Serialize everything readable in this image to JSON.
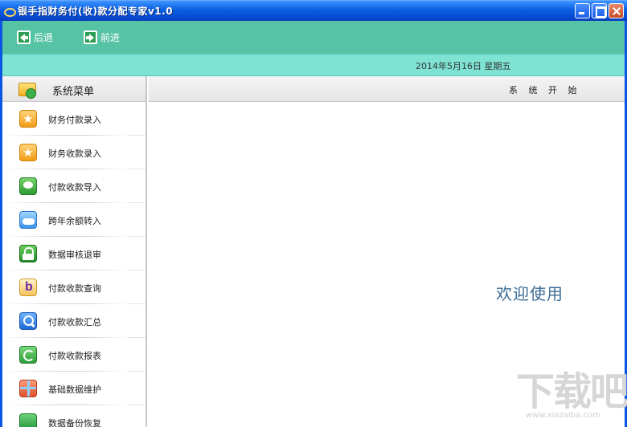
{
  "window": {
    "title": "银手指财务付(收)款分配专家v1.0"
  },
  "toolbar": {
    "back_label": "后退",
    "forward_label": "前进"
  },
  "infobar": {
    "date": "2014年5月16日  星期五"
  },
  "sidebar": {
    "title": "系统菜单",
    "items": [
      {
        "label": "财务付款录入",
        "icon": "star-icon"
      },
      {
        "label": "财务收款录入",
        "icon": "star-icon"
      },
      {
        "label": "付款收款导入",
        "icon": "chat-bubble-icon"
      },
      {
        "label": "跨年余额转入",
        "icon": "cloud-icon"
      },
      {
        "label": "数据审核退审",
        "icon": "lock-icon"
      },
      {
        "label": "付款收款查询",
        "icon": "b-letter-icon"
      },
      {
        "label": "付款收款汇总",
        "icon": "search-icon"
      },
      {
        "label": "付款收款报表",
        "icon": "refresh-icon"
      },
      {
        "label": "基础数据维护",
        "icon": "gift-icon"
      },
      {
        "label": "数据备份恢复",
        "icon": "share-icon"
      }
    ]
  },
  "main": {
    "header_title": "系 统 开 始",
    "welcome_text": "欢迎使用"
  },
  "watermark": {
    "text": "下载吧",
    "url": "www.xiazaiba.com"
  },
  "colors": {
    "toolbar": "#57c3a5",
    "infobar": "#7fe3d3",
    "titlebar": "#0a5fe0",
    "welcome": "#3b6b94"
  }
}
